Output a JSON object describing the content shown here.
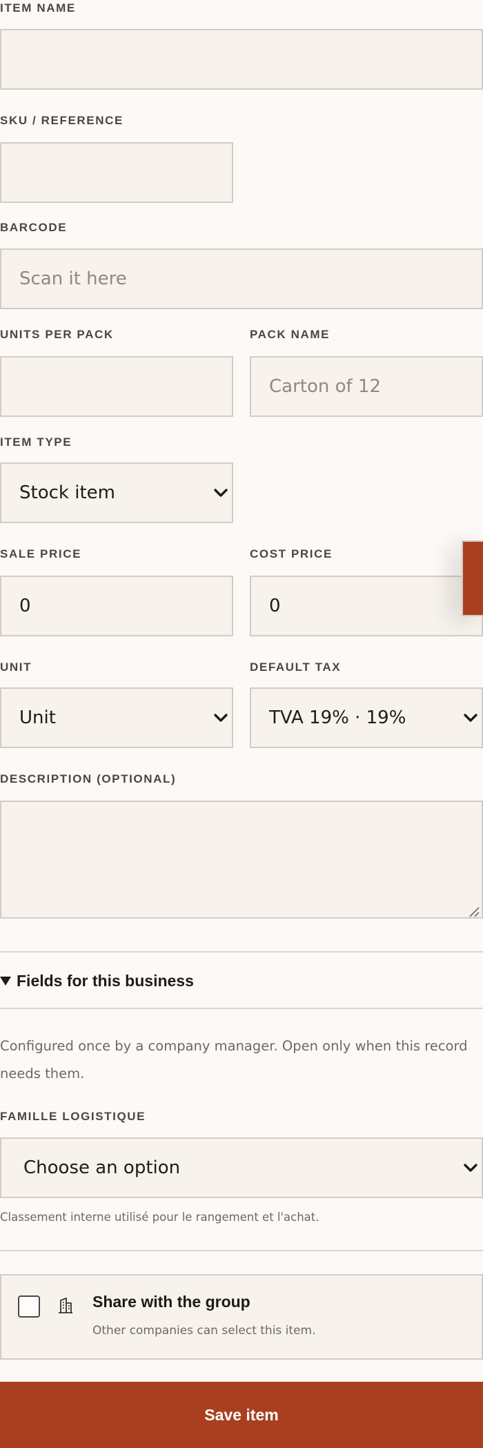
{
  "fields": {
    "item_name": {
      "label": "ITEM NAME",
      "value": "",
      "placeholder": ""
    },
    "sku": {
      "label": "SKU / REFERENCE",
      "value": "",
      "placeholder": ""
    },
    "barcode": {
      "label": "BARCODE",
      "value": "",
      "placeholder": "Scan it here"
    },
    "units_per_pack": {
      "label": "UNITS PER PACK",
      "value": "",
      "placeholder": ""
    },
    "pack_name": {
      "label": "PACK NAME",
      "value": "",
      "placeholder": "Carton of 12"
    },
    "item_type": {
      "label": "ITEM TYPE",
      "selected": "Stock item"
    },
    "sale_price": {
      "label": "SALE PRICE",
      "value": "0"
    },
    "cost_price": {
      "label": "COST PRICE",
      "value": "0"
    },
    "unit": {
      "label": "UNIT",
      "selected": "Unit"
    },
    "default_tax": {
      "label": "DEFAULT TAX",
      "selected": "TVA 19% · 19%"
    },
    "description": {
      "label": "DESCRIPTION (OPTIONAL)",
      "value": ""
    }
  },
  "business_fields": {
    "summary": "Fields for this business",
    "help": "Configured once by a company manager. Open only when this record needs them.",
    "famille_logistique": {
      "label": "FAMILLE LOGISTIQUE",
      "selected": "Choose an option",
      "hint": "Classement interne utilisé pour le rangement et l'achat."
    }
  },
  "share": {
    "title": "Share with the group",
    "subtitle": "Other companies can select this item.",
    "checked": false,
    "icon": "building-icon"
  },
  "actions": {
    "save_label": "Save item"
  },
  "colors": {
    "accent": "#a8401f",
    "background": "#fcf9f7",
    "field_bg": "#f7f2ec",
    "border": "#d4ccc4"
  }
}
